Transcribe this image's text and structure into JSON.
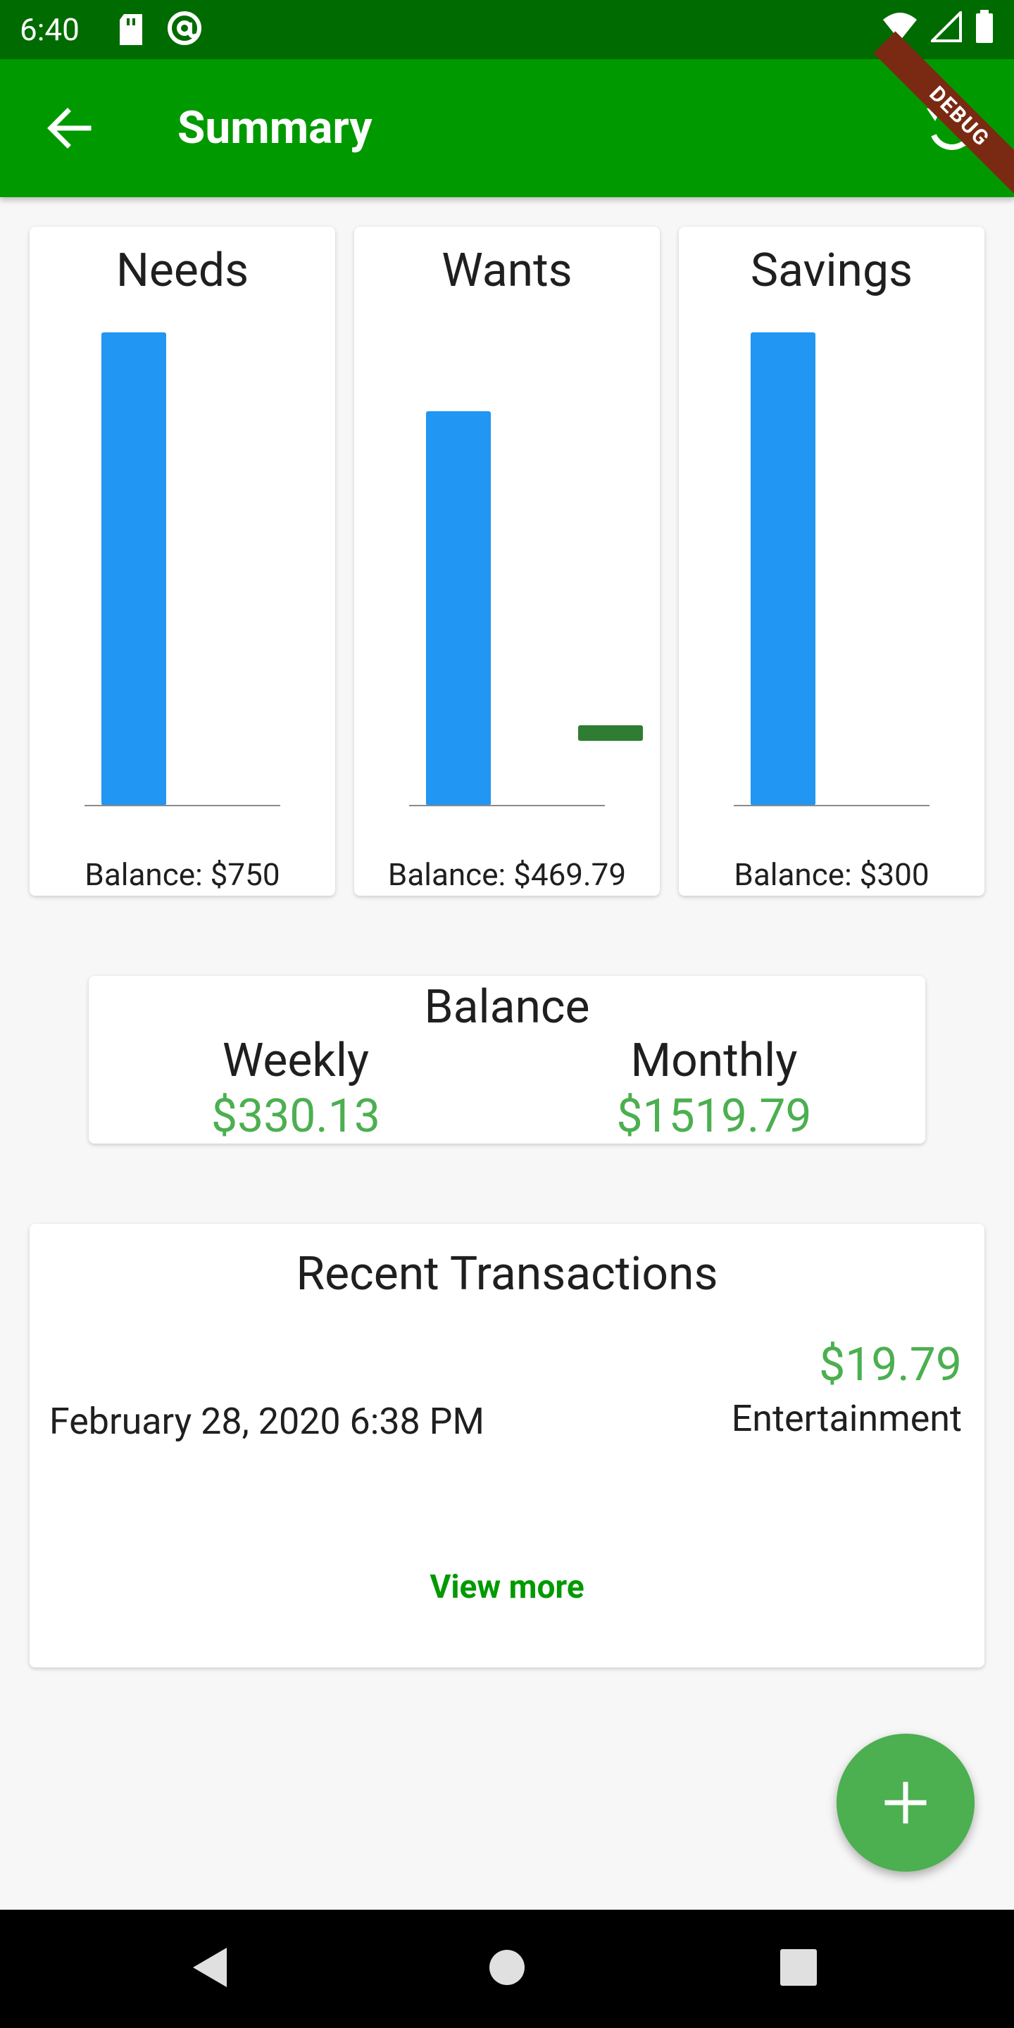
{
  "status_bar": {
    "time": "6:40",
    "icons": [
      "sd-card-icon",
      "at-sign-icon",
      "wifi-icon",
      "signal-icon",
      "battery-icon"
    ]
  },
  "app_bar": {
    "title": "Summary",
    "back_icon": "arrow-left-icon",
    "refresh_icon": "refresh-icon",
    "debug_label": "DEBUG",
    "color": "#009a00",
    "status_color": "#006b00"
  },
  "charts": [
    {
      "title": "Needs",
      "balance": "Balance: $750"
    },
    {
      "title": "Wants",
      "balance": "Balance: $469.79"
    },
    {
      "title": "Savings",
      "balance": "Balance: $300"
    }
  ],
  "chart_data": [
    {
      "type": "bar",
      "title": "Needs",
      "series": [
        {
          "values": [
            750
          ],
          "color": "#2196f3"
        },
        {
          "values": [
            0
          ],
          "color": "#2e7d32"
        }
      ],
      "ylim": [
        0,
        750
      ]
    },
    {
      "type": "bar",
      "title": "Wants",
      "series": [
        {
          "values": [
            500
          ],
          "color": "#2196f3"
        },
        {
          "values": [
            -19.79
          ],
          "color": "#2e7d32"
        }
      ],
      "ylim": [
        -19.79,
        600
      ]
    },
    {
      "type": "bar",
      "title": "Savings",
      "series": [
        {
          "values": [
            300
          ],
          "color": "#2196f3"
        },
        {
          "values": [
            0
          ],
          "color": "#2e7d32"
        }
      ],
      "ylim": [
        0,
        300
      ]
    }
  ],
  "balance": {
    "title": "Balance",
    "weekly_label": "Weekly",
    "weekly_value": "$330.13",
    "monthly_label": "Monthly",
    "monthly_value": "$1519.79",
    "value_color": "#4caf50"
  },
  "recent_transactions": {
    "title": "Recent Transactions",
    "items": [
      {
        "amount": "$19.79",
        "date": "February 28, 2020 6:38 PM",
        "category": "Entertainment"
      }
    ],
    "view_more": "View more"
  },
  "fab": {
    "icon": "plus-icon",
    "color": "#4caf50"
  },
  "nav_bar": {
    "icons": [
      "nav-back-icon",
      "nav-home-icon",
      "nav-recents-icon"
    ]
  }
}
